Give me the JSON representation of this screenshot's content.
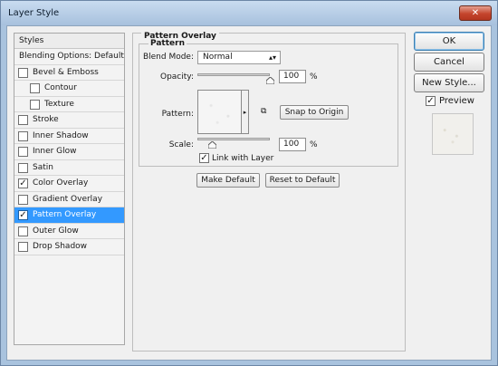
{
  "window": {
    "title": "Layer Style",
    "close_glyph": "✕"
  },
  "styles_panel": {
    "header": "Styles",
    "items": [
      {
        "label": "Blending Options: Default",
        "checkable": false,
        "checked": false,
        "indent": false,
        "selected": false
      },
      {
        "label": "Bevel & Emboss",
        "checkable": true,
        "checked": false,
        "indent": false,
        "selected": false
      },
      {
        "label": "Contour",
        "checkable": true,
        "checked": false,
        "indent": true,
        "selected": false
      },
      {
        "label": "Texture",
        "checkable": true,
        "checked": false,
        "indent": true,
        "selected": false
      },
      {
        "label": "Stroke",
        "checkable": true,
        "checked": false,
        "indent": false,
        "selected": false
      },
      {
        "label": "Inner Shadow",
        "checkable": true,
        "checked": false,
        "indent": false,
        "selected": false
      },
      {
        "label": "Inner Glow",
        "checkable": true,
        "checked": false,
        "indent": false,
        "selected": false
      },
      {
        "label": "Satin",
        "checkable": true,
        "checked": false,
        "indent": false,
        "selected": false
      },
      {
        "label": "Color Overlay",
        "checkable": true,
        "checked": true,
        "indent": false,
        "selected": false
      },
      {
        "label": "Gradient Overlay",
        "checkable": true,
        "checked": false,
        "indent": false,
        "selected": false
      },
      {
        "label": "Pattern Overlay",
        "checkable": true,
        "checked": true,
        "indent": false,
        "selected": true
      },
      {
        "label": "Outer Glow",
        "checkable": true,
        "checked": false,
        "indent": false,
        "selected": false
      },
      {
        "label": "Drop Shadow",
        "checkable": true,
        "checked": false,
        "indent": false,
        "selected": false
      }
    ]
  },
  "pattern_overlay": {
    "group_title": "Pattern Overlay",
    "subgroup_title": "Pattern",
    "blend_mode_label": "Blend Mode:",
    "blend_mode_value": "Normal",
    "opacity_label": "Opacity:",
    "opacity_value": "100",
    "opacity_unit": "%",
    "opacity_level": 1.0,
    "pattern_label": "Pattern:",
    "snap_button": "Snap to Origin",
    "scale_label": "Scale:",
    "scale_value": "100",
    "scale_unit": "%",
    "scale_level": 0.2,
    "link_label": "Link with Layer",
    "link_checked": true,
    "make_default_button": "Make Default",
    "reset_default_button": "Reset to Default"
  },
  "right_panel": {
    "ok_button": "OK",
    "cancel_button": "Cancel",
    "new_style_button": "New Style...",
    "preview_label": "Preview",
    "preview_checked": true
  },
  "icons": {
    "check": "✓",
    "dropdown": "▾",
    "pattern_dropdown": "▸",
    "new_preset": "⧉"
  },
  "colors": {
    "selection": "#3399ff",
    "title_bar": "#a7c1dd",
    "close_button": "#c4442c"
  }
}
